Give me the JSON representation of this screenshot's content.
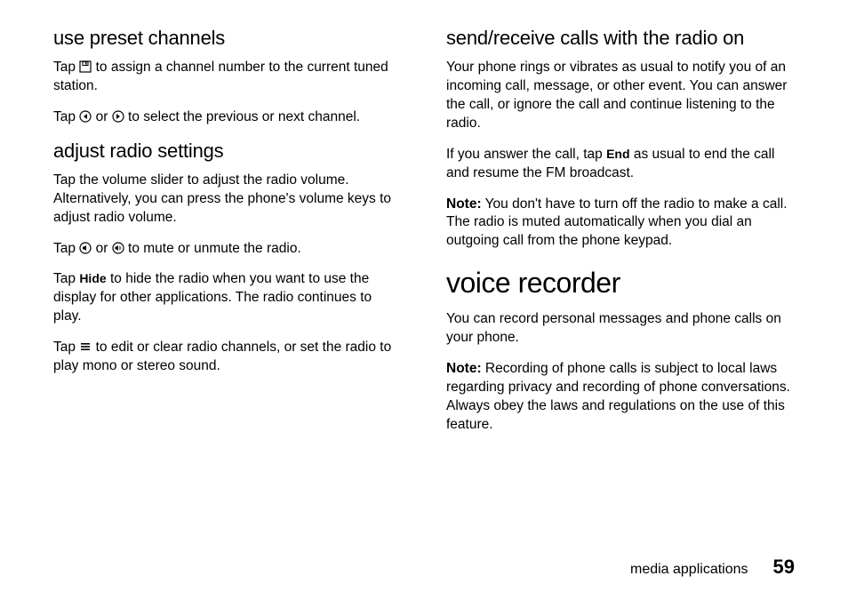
{
  "left": {
    "h_preset": "use preset channels",
    "preset_p1_a": "Tap ",
    "preset_p1_b": " to assign a channel number to the current tuned station.",
    "preset_p2_a": "Tap ",
    "preset_p2_b": " or ",
    "preset_p2_c": " to select the previous or next channel.",
    "h_adjust": "adjust radio settings",
    "adjust_p1": "Tap the volume slider to adjust the radio volume. Alternatively, you can press the phone's volume keys to adjust radio volume.",
    "adjust_p2_a": "Tap ",
    "adjust_p2_b": " or ",
    "adjust_p2_c": " to mute or unmute the radio.",
    "adjust_p3_a": "Tap ",
    "adjust_p3_hide": "Hide",
    "adjust_p3_b": " to hide the radio when you want to use the display for other applications. The radio continues to play.",
    "adjust_p4_a": "Tap ",
    "adjust_p4_b": " to edit or clear radio channels, or set the radio to play mono or stereo sound."
  },
  "right": {
    "h_calls": "send/receive calls with the radio on",
    "calls_p1": "Your phone rings or vibrates as usual to notify you of an incoming call, message, or other event. You can answer the call, or ignore the call and continue listening to the radio.",
    "calls_p2_a": "If you answer the call, tap ",
    "calls_p2_end": "End",
    "calls_p2_b": " as usual to end the call and resume the FM broadcast.",
    "calls_note_label": "Note:",
    "calls_note_body": " You don't have to turn off the radio to make a call. The radio is muted automatically when you dial an outgoing call from the phone keypad.",
    "h_voice": "voice recorder",
    "voice_p1": "You can record personal messages and phone calls on your phone.",
    "voice_note_label": "Note:",
    "voice_note_body": " Recording of phone calls is subject to local laws regarding privacy and recording of phone conversations. Always obey the laws and regulations on the use of this feature."
  },
  "footer": {
    "label": "media applications",
    "page": "59"
  }
}
